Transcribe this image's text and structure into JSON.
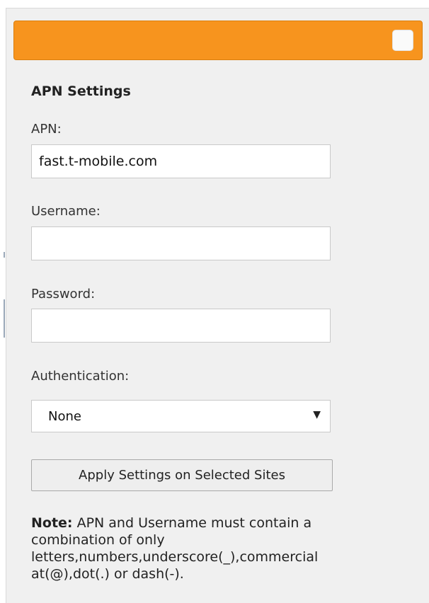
{
  "panel": {
    "header_color": "#f7941e",
    "header_checkbox_checked": false
  },
  "apn_settings": {
    "title": "APN Settings",
    "apn_label": "APN:",
    "apn_value": "fast.t-mobile.com",
    "username_label": "Username:",
    "username_value": "",
    "password_label": "Password:",
    "password_value": "",
    "authentication_label": "Authentication:",
    "authentication_selected": "None",
    "apply_button_label": "Apply Settings on Selected Sites",
    "note_title": "Note:",
    "note_lines": [
      "APN and Username must contain a",
      "combination of only",
      "letters,numbers,underscore(_),commercial",
      "at(@),dot(.) or dash(-)."
    ]
  }
}
